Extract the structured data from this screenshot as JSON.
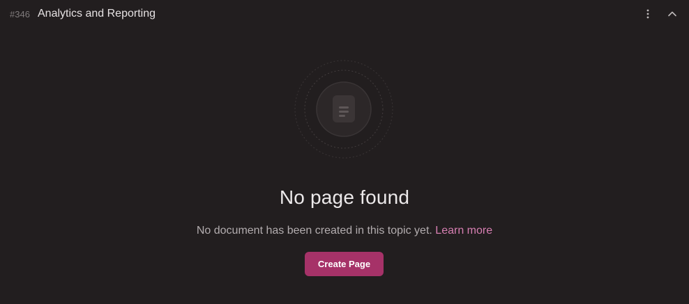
{
  "header": {
    "topic_id": "#346",
    "topic_title": "Analytics and Reporting",
    "more_icon": "more-vertical-icon",
    "collapse_icon": "chevron-up-icon"
  },
  "empty_state": {
    "icon": "document-icon",
    "title": "No page found",
    "description": "No document has been created in this topic yet.",
    "learn_more": "Learn more",
    "create_button": "Create Page"
  },
  "colors": {
    "background": "#221e1f",
    "accent": "#a63268",
    "link": "#d77fb2"
  }
}
